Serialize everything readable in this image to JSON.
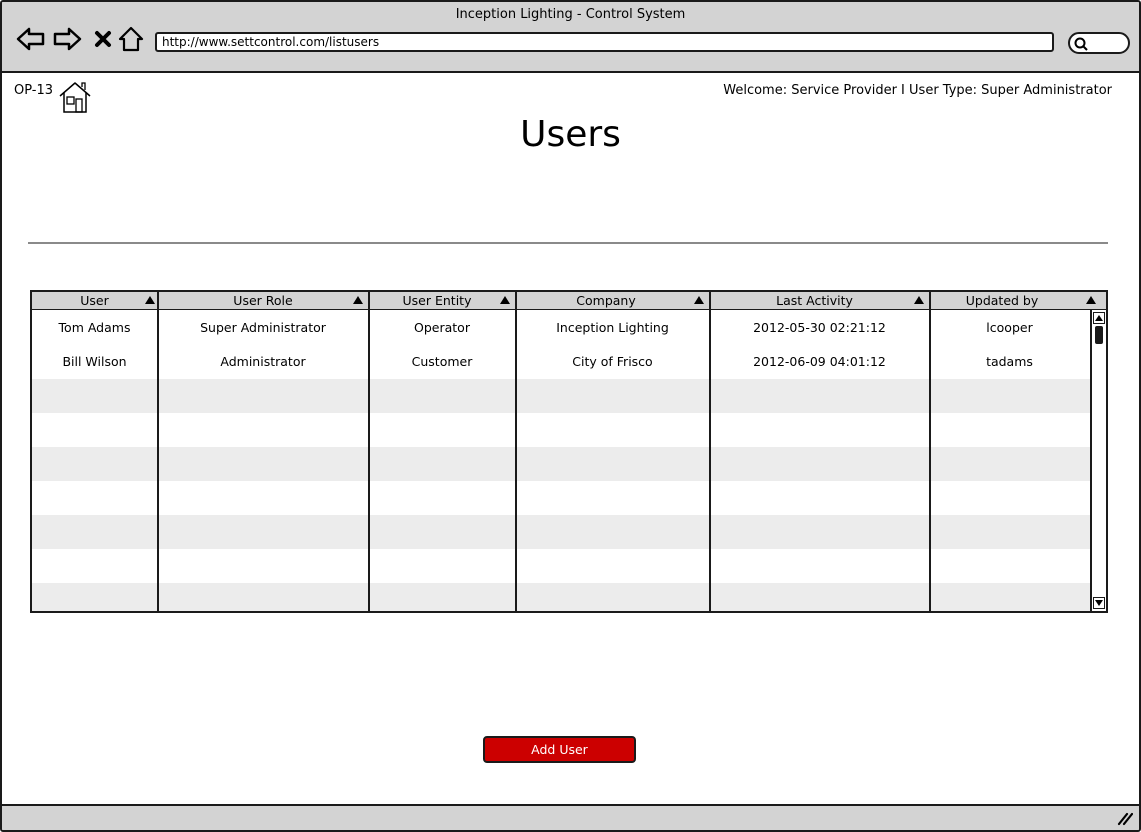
{
  "window": {
    "title": "Inception Lighting - Control System"
  },
  "browser": {
    "url": "http://www.settcontrol.com/listusers",
    "icons": [
      "back-arrow-icon",
      "forward-arrow-icon",
      "close-icon",
      "home-icon",
      "search-icon"
    ]
  },
  "header": {
    "page_id": "OP-13",
    "welcome": "Welcome: Service Provider I User Type: Super Administrator"
  },
  "page": {
    "title": "Users"
  },
  "table": {
    "columns": [
      "User",
      "User Role",
      "User Entity",
      "Company",
      "Last Activity",
      "Updated by"
    ],
    "rows": [
      [
        "Tom Adams",
        "Super Administrator",
        "Operator",
        "Inception Lighting",
        "2012-05-30 02:21:12",
        "lcooper"
      ],
      [
        "Bill Wilson",
        "Administrator",
        "Customer",
        "City of Frisco",
        "2012-06-09 04:01:12",
        "tadams"
      ]
    ]
  },
  "actions": {
    "add_user_label": "Add User"
  },
  "colors": {
    "accent": "#cc0000",
    "chrome": "#d3d3d3",
    "row_alt": "#ececec"
  }
}
